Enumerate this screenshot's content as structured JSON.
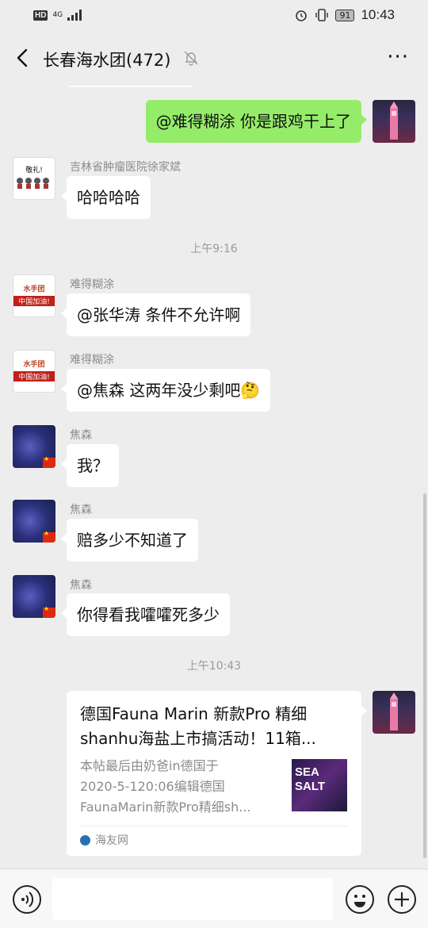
{
  "status_bar": {
    "network": "HD",
    "signal": "4G",
    "battery": "91",
    "time": "10:43"
  },
  "header": {
    "title": "长春海水团(472)",
    "back_icon": "chevron-left-icon",
    "mute_icon": "bell-off-icon",
    "more_label": "···"
  },
  "messages": [
    {
      "id": "m1",
      "side": "right",
      "text": "@难得糊涂  你是跟鸡干上了"
    },
    {
      "id": "m2",
      "side": "left",
      "sender": "吉林省肿瘤医院徐家斌",
      "text": "哈哈哈哈",
      "avatar_text": "敬礼!"
    },
    {
      "id": "t1",
      "type": "timestamp",
      "text": "上午9:16"
    },
    {
      "id": "m3",
      "side": "left",
      "sender": "难得糊涂",
      "text": "@张华涛  条件不允许啊",
      "avatar_text": "水手团",
      "avatar_sub": "中国加油!"
    },
    {
      "id": "m4",
      "side": "left",
      "sender": "难得糊涂",
      "text": "@焦森  这两年没少剩吧🤔",
      "avatar_text": "水手团",
      "avatar_sub": "中国加油!"
    },
    {
      "id": "m5",
      "side": "left",
      "sender": "焦森",
      "text": "我？"
    },
    {
      "id": "m6",
      "side": "left",
      "sender": "焦森",
      "text": "赔多少不知道了"
    },
    {
      "id": "m7",
      "side": "left",
      "sender": "焦森",
      "text": "你得看我嚯嚯死多少"
    },
    {
      "id": "t2",
      "type": "timestamp",
      "text": "上午10:43"
    }
  ],
  "link_card": {
    "title_line1": "德国Fauna Marin 新款Pro 精细",
    "title_line2": "shanhu海盐上市搞活动！11箱...",
    "desc_line1": "本帖最后由奶爸in德国于",
    "desc_line2": "2020-5-120:06编辑德国",
    "desc_line3": "FaunaMarin新款Pro精细sh...",
    "thumb_text": "SEA SALT",
    "source": "海友网"
  },
  "input_bar": {
    "voice_icon": "voice-icon",
    "emoji_icon": "emoji-icon",
    "plus_icon": "plus-icon"
  },
  "colors": {
    "background": "#ededed",
    "my_bubble": "#95ec69",
    "other_bubble": "#ffffff"
  }
}
